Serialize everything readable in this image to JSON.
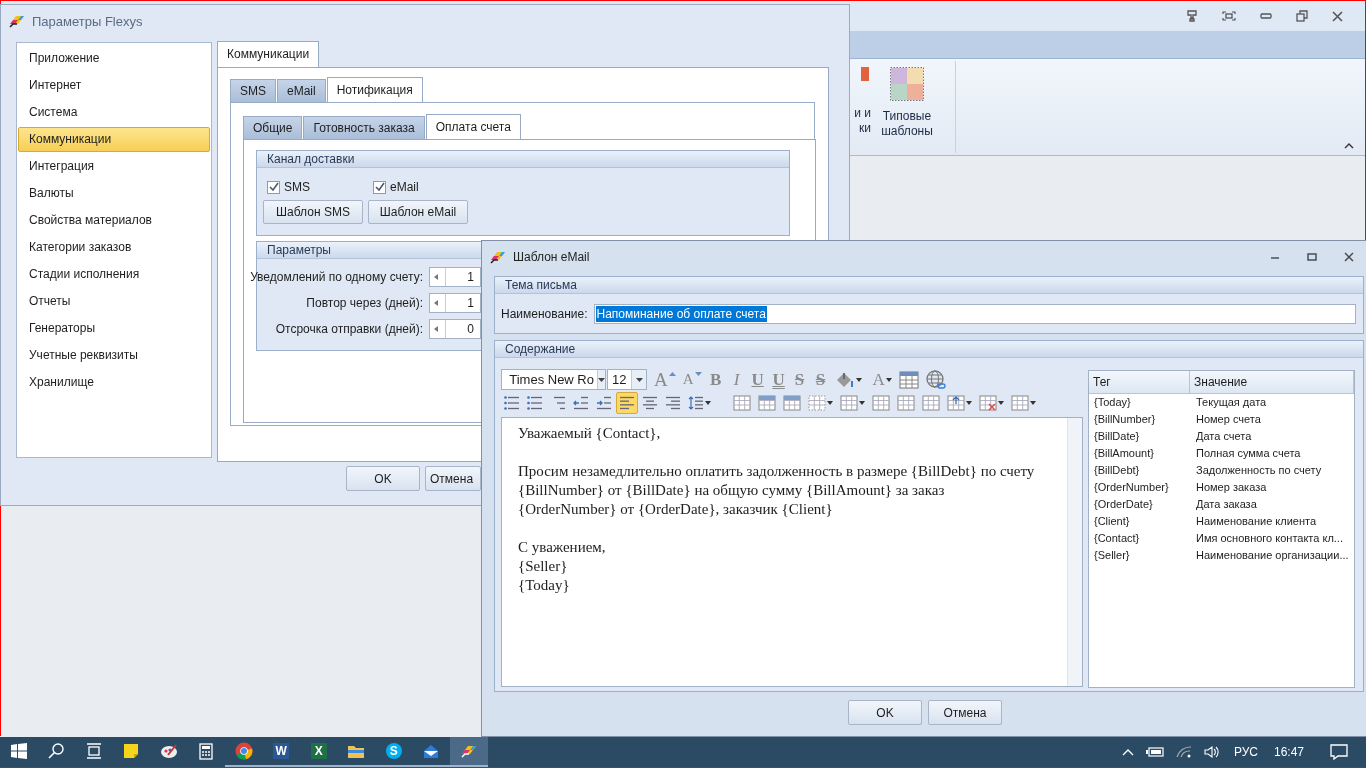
{
  "background_app": {
    "ribbon_partial_label": "и и ки",
    "ribbon_button": "Типовые шаблоны"
  },
  "settings": {
    "title": "Параметры Flexys",
    "nav": [
      {
        "label": "Приложение",
        "selected": false
      },
      {
        "label": "Интернет",
        "selected": false
      },
      {
        "label": "Система",
        "selected": false
      },
      {
        "label": "Коммуникации",
        "selected": true
      },
      {
        "label": "Интеграция",
        "selected": false
      },
      {
        "label": "Валюты",
        "selected": false
      },
      {
        "label": "Свойства материалов",
        "selected": false
      },
      {
        "label": "Категории заказов",
        "selected": false
      },
      {
        "label": "Стадии исполнения",
        "selected": false
      },
      {
        "label": "Отчеты",
        "selected": false
      },
      {
        "label": "Генераторы",
        "selected": false
      },
      {
        "label": "Учетные реквизиты",
        "selected": false
      },
      {
        "label": "Хранилище",
        "selected": false
      }
    ],
    "page_tab": "Коммуникации",
    "tabs": [
      {
        "label": "SMS",
        "selected": false
      },
      {
        "label": "eMail",
        "selected": false
      },
      {
        "label": "Нотификация",
        "selected": true
      }
    ],
    "subtabs": [
      {
        "label": "Общие",
        "selected": false
      },
      {
        "label": "Готовность заказа",
        "selected": false
      },
      {
        "label": "Оплата счета",
        "selected": true
      }
    ],
    "delivery_group": "Канал доставки",
    "channels": [
      {
        "label": "SMS",
        "checked": true
      },
      {
        "label": "eMail",
        "checked": true
      }
    ],
    "template_buttons": [
      "Шаблон SMS",
      "Шаблон eMail"
    ],
    "params_group": "Параметры",
    "params": [
      {
        "label": "Уведомлений по одному счету:",
        "value": "1"
      },
      {
        "label": "Повтор через (дней):",
        "value": "1"
      },
      {
        "label": "Отсрочка отправки (дней):",
        "value": "0"
      }
    ],
    "buttons": [
      "OK",
      "Отмена"
    ]
  },
  "email": {
    "title": "Шаблон eMail",
    "subject_group": "Тема письма",
    "name_label": "Наименование:",
    "name_value": "Напоминание об оплате счета",
    "name_selected": true,
    "content_group": "Содержание",
    "font": "Times New Ro",
    "size": "12",
    "format_tools": [
      {
        "kind": "grow-font",
        "label": "A",
        "menu": false
      },
      {
        "kind": "shrink-font",
        "label": "A",
        "menu": false
      },
      {
        "kind": "bold",
        "label": "B",
        "menu": false
      },
      {
        "kind": "italic",
        "label": "I",
        "menu": false
      },
      {
        "kind": "underline",
        "label": "U",
        "menu": false
      },
      {
        "kind": "double-underline",
        "label": "U",
        "menu": false
      },
      {
        "kind": "strikethrough",
        "label": "S",
        "menu": false
      },
      {
        "kind": "double-strikethrough",
        "label": "S",
        "menu": false
      },
      {
        "kind": "highlight",
        "menu": true
      },
      {
        "kind": "font-color",
        "label": "A",
        "menu": true
      },
      {
        "kind": "insert-table",
        "menu": false
      },
      {
        "kind": "hyperlink",
        "menu": false
      }
    ],
    "paragraph_tools": [
      {
        "kind": "bullets",
        "selected": false,
        "menu": false
      },
      {
        "kind": "numbering",
        "selected": false,
        "menu": false
      },
      {
        "kind": "multilevel",
        "selected": false,
        "menu": false
      },
      {
        "kind": "outdent",
        "selected": false,
        "menu": false
      },
      {
        "kind": "indent",
        "selected": false,
        "menu": false
      },
      {
        "kind": "align-left",
        "selected": true,
        "menu": false
      },
      {
        "kind": "align-center",
        "selected": false,
        "menu": false
      },
      {
        "kind": "align-right",
        "selected": false,
        "menu": false
      },
      {
        "kind": "line-spacing",
        "selected": false,
        "menu": true
      }
    ],
    "table_tools": [
      {
        "kind": "table-properties",
        "menu": false
      },
      {
        "kind": "table-style",
        "menu": false
      },
      {
        "kind": "table",
        "menu": false
      },
      {
        "kind": "borders",
        "menu": true
      },
      {
        "kind": "insert-rows",
        "menu": true
      },
      {
        "kind": "merge-cells",
        "menu": false
      },
      {
        "kind": "split-cells",
        "menu": false
      },
      {
        "kind": "split-table",
        "menu": false
      },
      {
        "kind": "insert-above",
        "menu": true
      },
      {
        "kind": "delete-table",
        "menu": true
      },
      {
        "kind": "paragraph",
        "menu": true
      }
    ],
    "body": [
      "Уважаемый {Contact},",
      "Просим незамедлительно оплатить задолженность в размере {BillDebt} по счету {BillNumber} от {BillDate} на общую сумму {BillAmount} за заказ {OrderNumber} от {OrderDate}, заказчик {Client}",
      "С уважением,\n{Seller}\n{Today}"
    ],
    "tag_table": {
      "columns": [
        "Тег",
        "Значение"
      ],
      "rows": [
        [
          "{Today}",
          "Текущая дата"
        ],
        [
          "{BillNumber}",
          "Номер счета"
        ],
        [
          "{BillDate}",
          "Дата счета"
        ],
        [
          "{BillAmount}",
          "Полная сумма счета"
        ],
        [
          "{BillDebt}",
          "Задолженность по счету"
        ],
        [
          "{OrderNumber}",
          "Номер заказа"
        ],
        [
          "{OrderDate}",
          "Дата заказа"
        ],
        [
          "{Client}",
          "Наименование клиента"
        ],
        [
          "{Contact}",
          "Имя основного контакта кл..."
        ],
        [
          "{Seller}",
          "Наименование организации..."
        ]
      ]
    },
    "buttons": [
      "OK",
      "Отмена"
    ]
  },
  "taskbar": {
    "apps": [
      {
        "kind": "start",
        "running": false,
        "selected": false
      },
      {
        "kind": "search",
        "running": false,
        "selected": false
      },
      {
        "kind": "task-view",
        "running": false,
        "selected": false
      },
      {
        "kind": "notes",
        "running": false,
        "selected": false
      },
      {
        "kind": "paint",
        "running": false,
        "selected": false
      },
      {
        "kind": "calculator",
        "running": false,
        "selected": false
      },
      {
        "kind": "browser",
        "running": true,
        "selected": false
      },
      {
        "kind": "word",
        "label": "W",
        "running": true,
        "selected": false
      },
      {
        "kind": "excel",
        "label": "X",
        "running": true,
        "selected": false
      },
      {
        "kind": "folder",
        "running": true,
        "selected": false
      },
      {
        "kind": "skype",
        "label": "S",
        "running": true,
        "selected": false
      },
      {
        "kind": "mail",
        "running": true,
        "selected": false
      },
      {
        "kind": "flexys",
        "running": true,
        "selected": true
      }
    ],
    "language": "РУС",
    "time": "16:47"
  }
}
